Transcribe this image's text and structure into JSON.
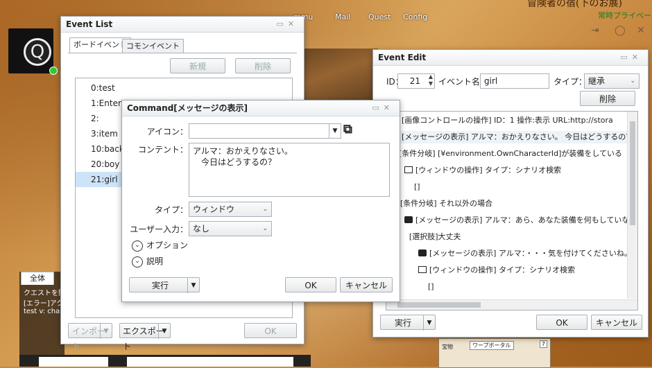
{
  "background": {
    "top_nav": [
      "mmu",
      "Mail",
      "Quest",
      "Config"
    ],
    "top_title": "冒険者の宿(下のお展)",
    "private_label": "常時プライベート",
    "avatar_letter": "Q",
    "chat": {
      "tab": "全体",
      "lines": [
        "クエストを開",
        "[エラー]アクラ",
        "test  v: cha"
      ]
    },
    "minimap": {
      "left_label": "宝物",
      "right_label": "ワープボータル",
      "badge": "7"
    }
  },
  "event_list": {
    "title": "Event List",
    "tabs": [
      "ボードイベント",
      "コモンイベント"
    ],
    "new_label": "新規",
    "delete_label": "削除",
    "items": [
      "0:test",
      "1:Enter",
      "2:",
      "3:item",
      "10:back",
      "20:boy",
      "21:girl"
    ],
    "selected_index": 6,
    "import_label": "インポート",
    "export_label": "エクスポート",
    "ok_label": "OK"
  },
  "command_dialog": {
    "title": "Command[メッセージの表示]",
    "icon_label": "アイコン：",
    "icon_value": "",
    "content_label": "コンテント：",
    "content_value": "アルマ：おかえりなさい。\n　今日はどうするの？",
    "type_label": "タイプ：",
    "type_value": "ウィンドウ",
    "user_input_label": "ユーザー入力：",
    "user_input_value": "なし",
    "option_label": "オプション",
    "description_label": "説明",
    "run_label": "実行",
    "ok_label": "OK",
    "cancel_label": "キャンセル"
  },
  "event_edit": {
    "title": "Event Edit",
    "id_label": "ID：",
    "id_value": "21",
    "name_label": "イベント名：",
    "name_value": "girl",
    "type_label": "タイプ：",
    "type_value": "継承",
    "delete_label": "削除",
    "tree": [
      {
        "text": "[画像コントロールの操作]   ID：1 操作:表示 URL:http://stora",
        "icon": "image",
        "indent": 0
      },
      {
        "text": "[メッセージの表示] アルマ：おかえりなさい。  今日はどうするの？",
        "icon": "msg",
        "indent": 0
      },
      {
        "text": "[条件分岐] [¥environment.OwnCharacterId]が装備をしている",
        "icon": "branch",
        "indent": 0
      },
      {
        "text": "[ウィンドウの操作] タイプ：シナリオ検索",
        "icon": "window",
        "indent": 1
      },
      {
        "text": "[]",
        "icon": "",
        "indent": 2
      },
      {
        "text": "[条件分岐] それ以外の場合",
        "icon": "",
        "indent": 1
      },
      {
        "text": "[メッセージの表示] アルマ：あら、あなた装備を何もしていな",
        "icon": "msg",
        "indent": 1
      },
      {
        "text": "[選択肢]大丈夫",
        "icon": "",
        "indent": 2
      },
      {
        "text": "[メッセージの表示] アルマ：・・・気を付けてくださいね。",
        "icon": "msg",
        "indent": 3
      },
      {
        "text": "[ウィンドウの操作] タイプ：シナリオ検索",
        "icon": "window",
        "indent": 3
      },
      {
        "text": "[]",
        "icon": "",
        "indent": 4
      }
    ],
    "run_label": "実行",
    "ok_label": "OK",
    "cancel_label": "キャンセル"
  }
}
